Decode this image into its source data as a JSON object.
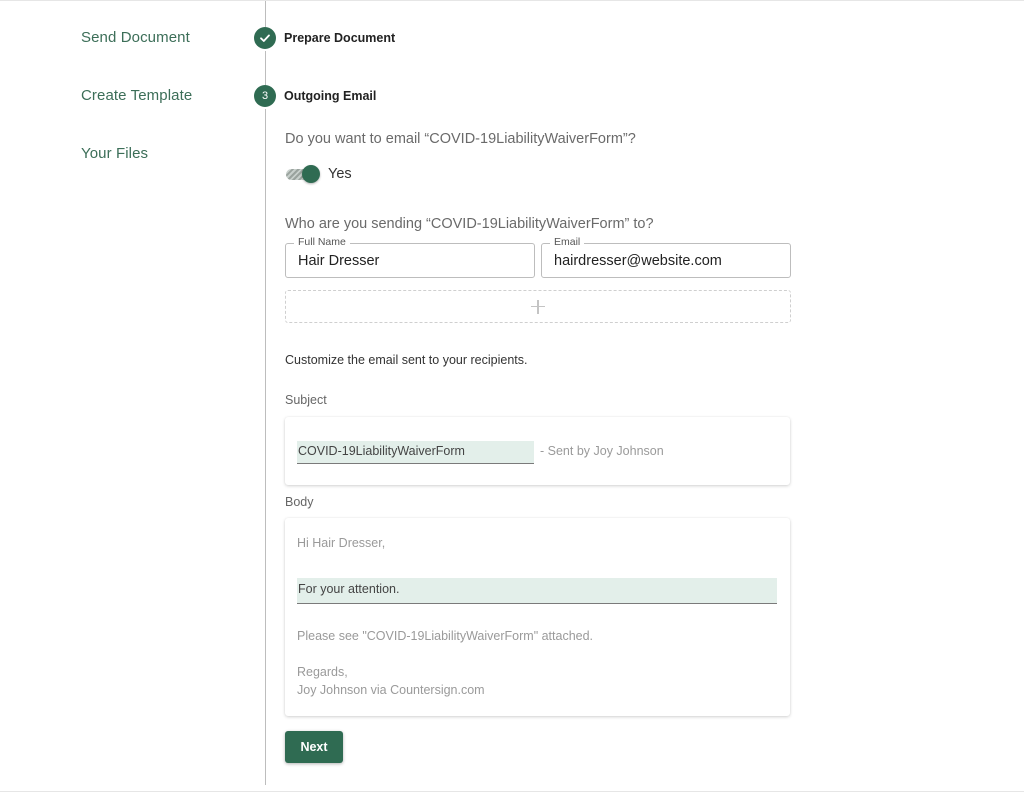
{
  "sidebar": {
    "items": [
      {
        "label": "Send Document"
      },
      {
        "label": "Create Template"
      },
      {
        "label": "Your Files"
      }
    ]
  },
  "stepper": {
    "steps": [
      {
        "label": "Prepare Document",
        "status": "completed",
        "icon": "check-icon"
      },
      {
        "label": "Outgoing Email",
        "status": "active",
        "number": "3"
      }
    ]
  },
  "email_step": {
    "question": "Do you want to email “COVID-19LiabilityWaiverForm”?",
    "toggle": {
      "label": "Yes",
      "on": true
    },
    "recipients_question": "Who are you sending “COVID-19LiabilityWaiverForm” to?",
    "recipient": {
      "full_name_label": "Full Name",
      "full_name": "Hair Dresser",
      "email_label": "Email",
      "email": "hairdresser@website.com"
    },
    "add_recipient_icon": "plus-icon",
    "customize_text": "Customize the email sent to your recipients.",
    "subject": {
      "label": "Subject",
      "value": "COVID-19LiabilityWaiverForm",
      "suffix": "- Sent by Joy Johnson"
    },
    "body": {
      "label": "Body",
      "greeting": "Hi Hair Dresser,",
      "message": "For your attention.",
      "attachment_line": "Please see \"COVID-19LiabilityWaiverForm\" attached.",
      "closing": "Regards,",
      "signature": "Joy Johnson via Countersign.com"
    },
    "next_label": "Next"
  },
  "colors": {
    "accent": "#2f6b52",
    "nav_text": "#3c6e58",
    "highlight": "#e3efea"
  }
}
